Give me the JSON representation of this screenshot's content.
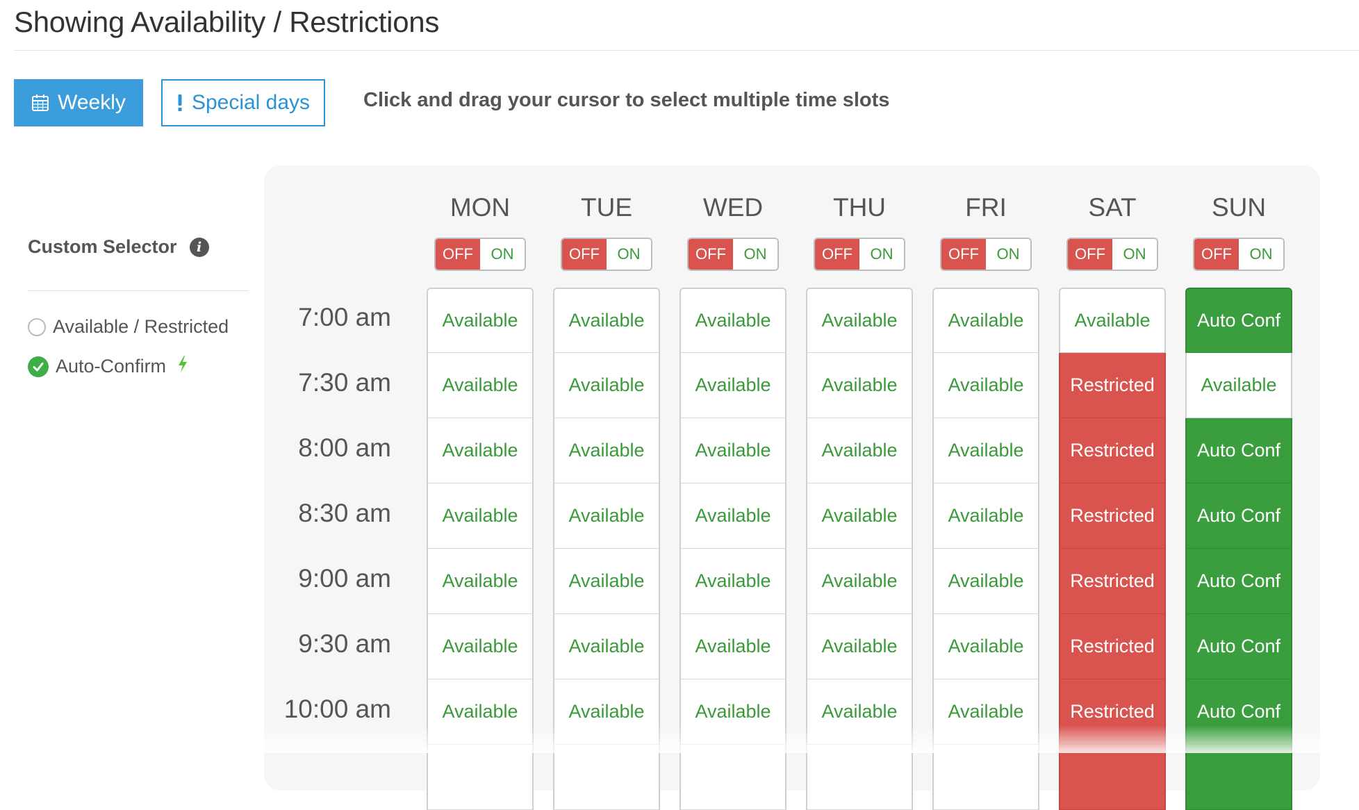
{
  "header": {
    "title": "Showing Availability / Restrictions"
  },
  "tabs": {
    "weekly_label": "Weekly",
    "weekly_icon": "calendar-icon",
    "special_label": "Special days",
    "special_icon": "exclamation-icon"
  },
  "hint": "Click and drag your cursor to select multiple time slots",
  "sidebar": {
    "title": "Custom Selector",
    "options": [
      {
        "label": "Available / Restricted",
        "selected": false
      },
      {
        "label": "Auto-Confirm",
        "selected": true,
        "icon": "lightning-bolt-icon"
      }
    ]
  },
  "colors": {
    "primary": "#3b9ddb",
    "available_text": "#3a9a3a",
    "restricted": "#d9534f",
    "auto_confirm": "#3a9e3e"
  },
  "toggle": {
    "off_label": "OFF",
    "on_label": "ON"
  },
  "days": [
    {
      "label": "MON",
      "toggle": "OFF"
    },
    {
      "label": "TUE",
      "toggle": "OFF"
    },
    {
      "label": "WED",
      "toggle": "OFF"
    },
    {
      "label": "THU",
      "toggle": "OFF"
    },
    {
      "label": "FRI",
      "toggle": "OFF"
    },
    {
      "label": "SAT",
      "toggle": "OFF"
    },
    {
      "label": "SUN",
      "toggle": "OFF"
    }
  ],
  "times": [
    "7:00 am",
    "7:30 am",
    "8:00 am",
    "8:30 am",
    "9:00 am",
    "9:30 am",
    "10:00 am"
  ],
  "grid": [
    [
      "Available",
      "Available",
      "Available",
      "Available",
      "Available",
      "Available",
      "Auto Conf"
    ],
    [
      "Available",
      "Available",
      "Available",
      "Available",
      "Available",
      "Restricted",
      "Available"
    ],
    [
      "Available",
      "Available",
      "Available",
      "Available",
      "Available",
      "Restricted",
      "Auto Conf"
    ],
    [
      "Available",
      "Available",
      "Available",
      "Available",
      "Available",
      "Restricted",
      "Auto Conf"
    ],
    [
      "Available",
      "Available",
      "Available",
      "Available",
      "Available",
      "Restricted",
      "Auto Conf"
    ],
    [
      "Available",
      "Available",
      "Available",
      "Available",
      "Available",
      "Restricted",
      "Auto Conf"
    ],
    [
      "Available",
      "Available",
      "Available",
      "Available",
      "Available",
      "Restricted",
      "Auto Conf"
    ]
  ]
}
